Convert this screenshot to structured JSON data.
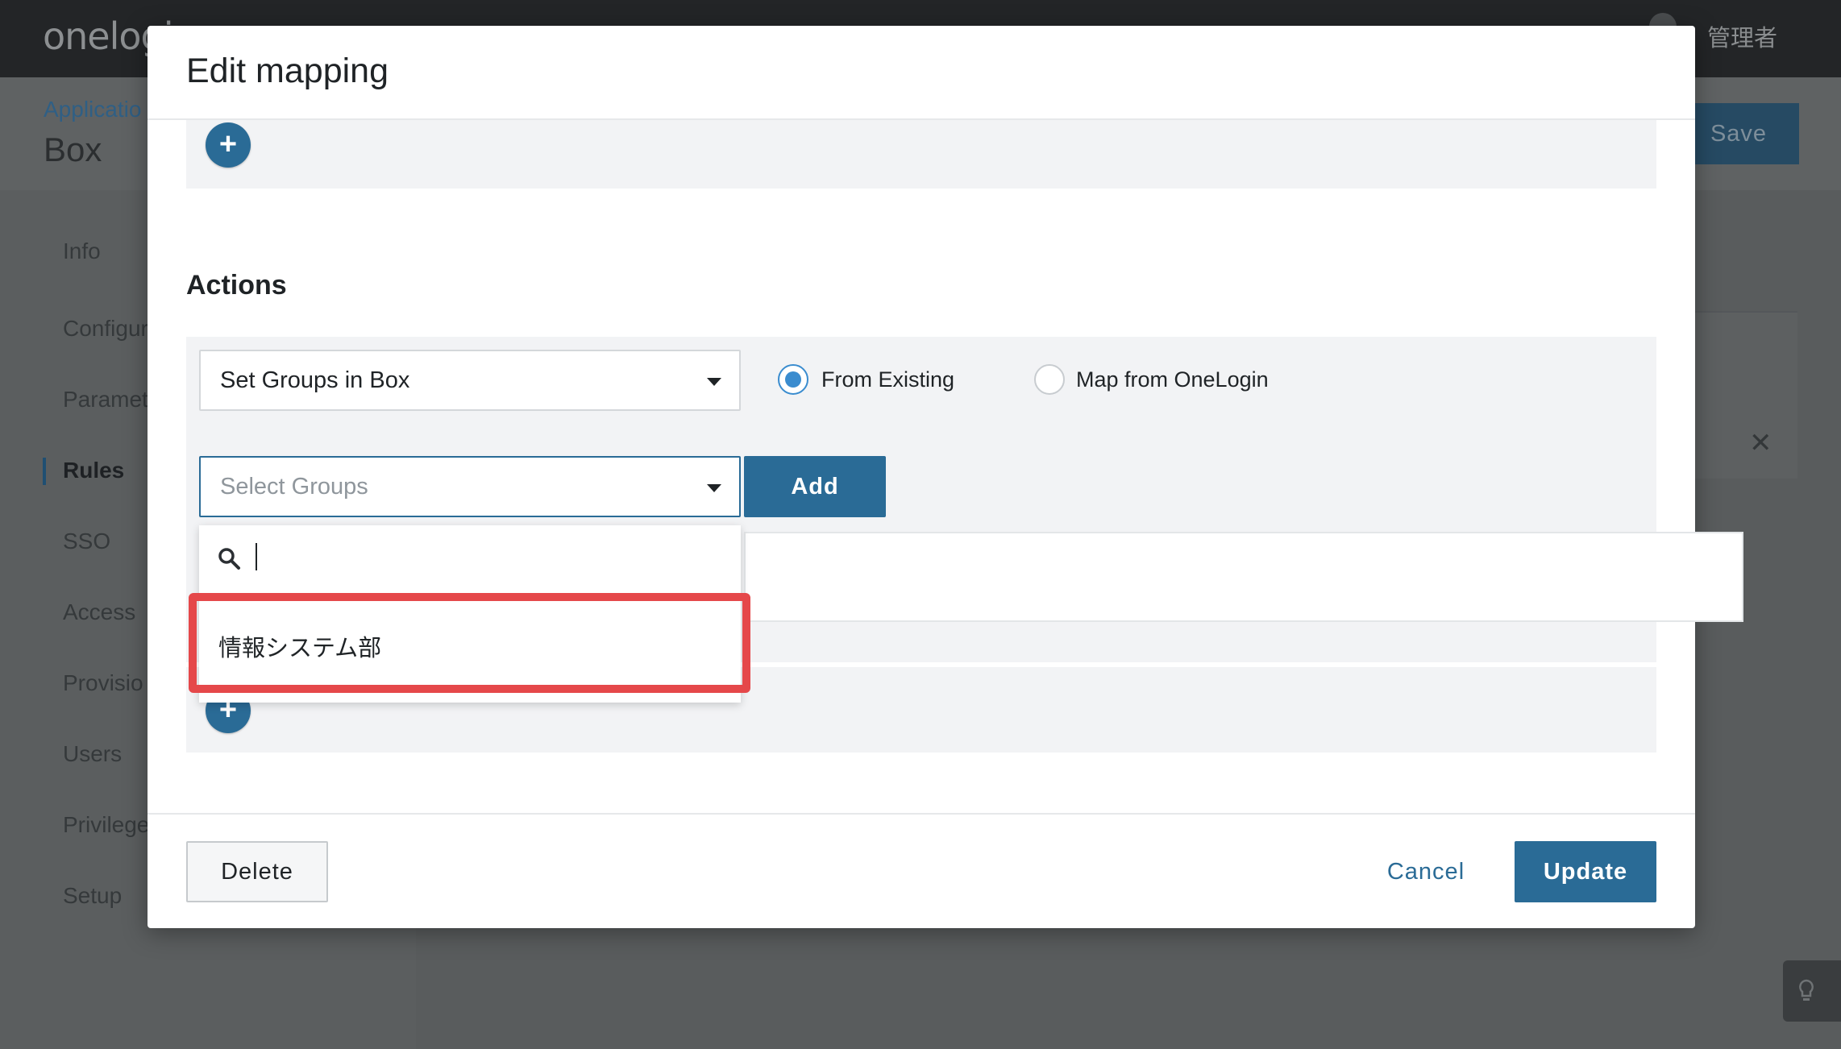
{
  "topbar": {
    "logo": "onelogi",
    "user_name": "管理者"
  },
  "page": {
    "breadcrumb": "Applicatio",
    "app_title": "Box",
    "save_label": "Save"
  },
  "side_nav": {
    "items": [
      {
        "label": "Info"
      },
      {
        "label": "Configur"
      },
      {
        "label": "Paramet"
      },
      {
        "label": "Rules"
      },
      {
        "label": "SSO"
      },
      {
        "label": "Access"
      },
      {
        "label": "Provisio"
      },
      {
        "label": "Users"
      },
      {
        "label": "Privilege"
      },
      {
        "label": "Setup"
      }
    ],
    "active_item": "Rules"
  },
  "modal": {
    "title": "Edit mapping",
    "actions_heading": "Actions",
    "action_select_value": "Set Groups in Box",
    "radio_from_existing": "From Existing",
    "radio_map_from_onelogin": "Map from OneLogin",
    "selected_radio": "From Existing",
    "groups_select_placeholder": "Select Groups",
    "add_label": "Add",
    "dropdown": {
      "search_value": "",
      "options": [
        {
          "label": "情報システム部"
        }
      ]
    },
    "delete_label": "Delete",
    "cancel_label": "Cancel",
    "update_label": "Update"
  },
  "colors": {
    "primary": "#2a6b96",
    "radio_selected": "#3a8ccf",
    "highlight": "#e5484a",
    "overlay": "#5b5e5f"
  },
  "icons": [
    "plus-icon",
    "search-icon",
    "chevron-down-icon",
    "close-icon",
    "lightbulb-icon"
  ]
}
